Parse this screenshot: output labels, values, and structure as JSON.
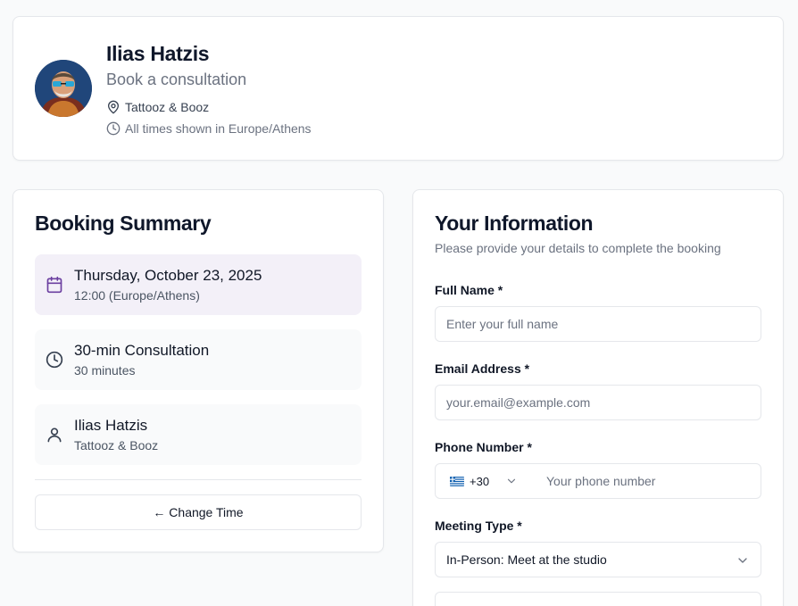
{
  "header": {
    "host_name": "Ilias Hatzis",
    "subtitle": "Book a consultation",
    "location": "Tattooz & Booz",
    "timezone_note": "All times shown in Europe/Athens",
    "icons": {
      "location": "map-pin-icon",
      "timezone": "clock-icon"
    }
  },
  "summary": {
    "title": "Booking Summary",
    "date": {
      "label": "Thursday, October 23, 2025",
      "sub": "12:00 (Europe/Athens)",
      "icon": "calendar-icon"
    },
    "service": {
      "label": "30-min Consultation",
      "sub": "30 minutes",
      "icon": "clock-icon"
    },
    "host": {
      "label": "Ilias Hatzis",
      "sub": "Tattooz & Booz",
      "icon": "user-icon"
    },
    "change_button": "← Change Time"
  },
  "info": {
    "title": "Your Information",
    "description": "Please provide your details to complete the booking",
    "full_name": {
      "label": "Full Name *",
      "placeholder": "Enter your full name",
      "value": ""
    },
    "email": {
      "label": "Email Address *",
      "placeholder": "your.email@example.com",
      "value": ""
    },
    "phone": {
      "label": "Phone Number *",
      "country_code": "+30",
      "placeholder": "Your phone number",
      "value": ""
    },
    "meeting_type": {
      "label": "Meeting Type *",
      "selected": "In-Person: Meet at the studio"
    }
  },
  "colors": {
    "accent": "#6b3fa0",
    "active_row_bg": "#f3f0f8",
    "border": "#e5e7eb",
    "muted_text": "#6b7280"
  }
}
